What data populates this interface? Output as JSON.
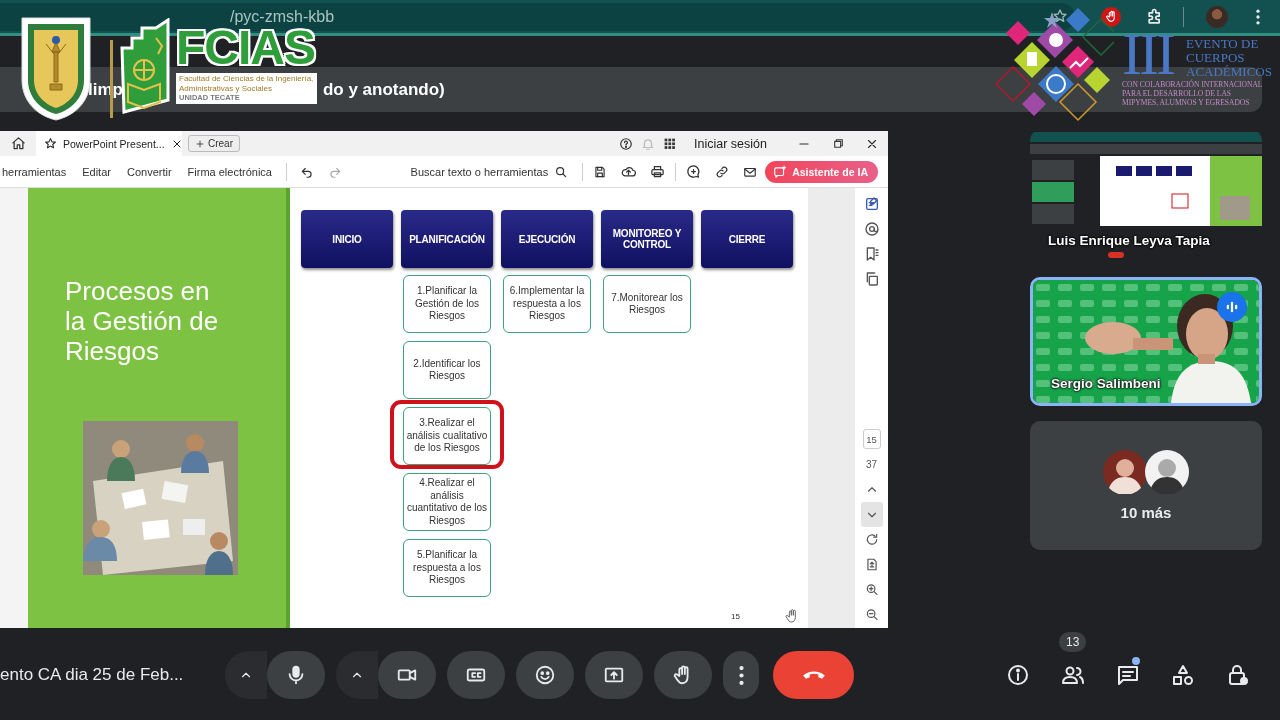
{
  "browser": {
    "url": "/pyc-zmsh-kbb",
    "title_parts": [
      "limp",
      "do y anotando)"
    ]
  },
  "faculty_logo": {
    "name": "FCIAS",
    "lines": [
      "Facultad de Ciencias de la Ingeniería,",
      "Administrativas y Sociales"
    ],
    "campus": "UNIDAD TECATE"
  },
  "event_logo": {
    "numeral": "III",
    "lines": [
      "EVENTO DE",
      "CUERPOS",
      "ACADÉMICOS"
    ],
    "subtitle": [
      "CON COLABORACIÓN INTERNACIONAL",
      "PARA EL DESARROLLO DE LAS",
      "MIPYMES, ALUMNOS Y EGRESADOS"
    ]
  },
  "pdf_viewer": {
    "tabs": [
      {
        "label": "PowerPoint Present...",
        "selected": true
      }
    ],
    "new_tab": "Crear",
    "sign_in": "Iniciar sesión",
    "menu": [
      "herramientas",
      "Editar",
      "Convertir",
      "Firma electrónica"
    ],
    "search": "Buscar texto o herramientas",
    "assistant": "Asistente de IA",
    "page": "15",
    "total_pages": "37"
  },
  "slide": {
    "title": "Procesos en la Gestión de Riesgos",
    "page_number": "15",
    "phases": [
      {
        "name": "INICIO"
      },
      {
        "name": "PLANIFICACIÓN",
        "steps": [
          {
            "text": "1.Planificar la Gestión de los Riesgos",
            "highlighted": false
          },
          {
            "text": "2.Identificar los Riesgos",
            "highlighted": false
          },
          {
            "text": "3.Realizar el análisis cualitativo de los Riesgos",
            "highlighted": true
          },
          {
            "text": "4.Realizar el análisis cuantitativo de los Riesgos",
            "highlighted": false
          },
          {
            "text": "5.Planificar la respuesta a los Riesgos",
            "highlighted": false
          }
        ]
      },
      {
        "name": "EJECUCIÓN",
        "steps": [
          {
            "text": "6.Implementar la respuesta a los Riesgos",
            "highlighted": false
          }
        ]
      },
      {
        "name": "MONITOREO Y CONTROL",
        "steps": [
          {
            "text": "7.Monitorear los Riesgos",
            "highlighted": false
          }
        ]
      },
      {
        "name": "CIERRE"
      }
    ]
  },
  "meet": {
    "tiles": [
      {
        "kind": "screen",
        "name": "Luis Enrique Leyva Tapia",
        "speaking": false
      },
      {
        "kind": "video",
        "name": "Sergio Salimbeni",
        "speaking": true
      }
    ],
    "others": "10 más",
    "meeting_name": "ento CA dia 25 de Feb...",
    "participant_count": "13",
    "chat_unread": true
  }
}
